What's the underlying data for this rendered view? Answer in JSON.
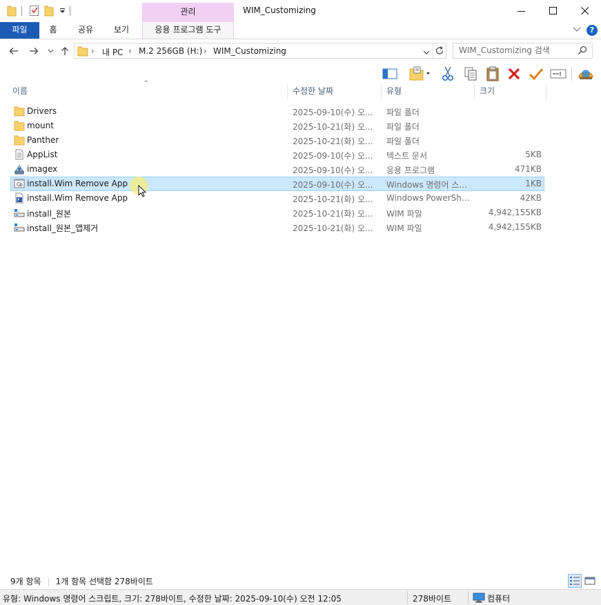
{
  "titlebar": {
    "title": "WIM_Customizing",
    "context_tab": "관리"
  },
  "ribbon": {
    "tabs": [
      "파일",
      "홈",
      "공유",
      "보기"
    ],
    "context_tool_tab": "응용 프로그램 도구",
    "help_label": "?"
  },
  "address": {
    "segments": [
      "내 PC",
      "M.2 256GB (H:)",
      "WIM_Customizing"
    ]
  },
  "search": {
    "placeholder": "WIM_Customizing 검색"
  },
  "columns": {
    "name": "이름",
    "date": "수정한 날짜",
    "type": "유형",
    "size": "크기"
  },
  "files": [
    {
      "name": "Drivers",
      "date": "2025-09-10(수) 오...",
      "type": "파일 폴더",
      "size": "",
      "icon": "folder-icon"
    },
    {
      "name": "mount",
      "date": "2025-10-21(화) 오...",
      "type": "파일 폴더",
      "size": "",
      "icon": "folder-icon"
    },
    {
      "name": "Panther",
      "date": "2025-10-21(화) 오...",
      "type": "파일 폴더",
      "size": "",
      "icon": "folder-icon"
    },
    {
      "name": "AppList",
      "date": "2025-09-10(수) 오...",
      "type": "텍스트 문서",
      "size": "5KB",
      "icon": "text-document-icon"
    },
    {
      "name": "imagex",
      "date": "2025-09-10(수) 오...",
      "type": "응용 프로그램",
      "size": "471KB",
      "icon": "application-icon"
    },
    {
      "name": "install.Wim Remove App",
      "date": "2025-09-10(수) 오...",
      "type": "Windows 명령어 스...",
      "size": "1KB",
      "icon": "batch-script-icon"
    },
    {
      "name": "install.Wim Remove App",
      "date": "2025-10-21(화) 오...",
      "type": "Windows PowerShell...",
      "size": "42KB",
      "icon": "powershell-script-icon"
    },
    {
      "name": "install_원본",
      "date": "2025-10-21(화) 오...",
      "type": "WIM 파일",
      "size": "4,942,155KB",
      "icon": "wim-file-icon"
    },
    {
      "name": "install_원본_앱제거",
      "date": "2025-10-21(화) 오...",
      "type": "WIM 파일",
      "size": "4,942,155KB",
      "icon": "wim-file-icon"
    }
  ],
  "status": {
    "item_count": "9개 항목",
    "selection": "1개 항목 선택함 278바이트"
  },
  "detailbar": {
    "description": "유형: Windows 명령어 스크립트, 크기: 278바이트, 수정한 날짜: 2025-09-10(수) 오전 12:05",
    "size": "278바이트",
    "location": "컴퓨터"
  },
  "colors": {
    "file_tab": "#1c5bb5",
    "context_tab": "#f1d0f3",
    "selection_bg": "#cce8ff",
    "selection_border": "#99d1ff",
    "folder": "#f7d26b"
  }
}
